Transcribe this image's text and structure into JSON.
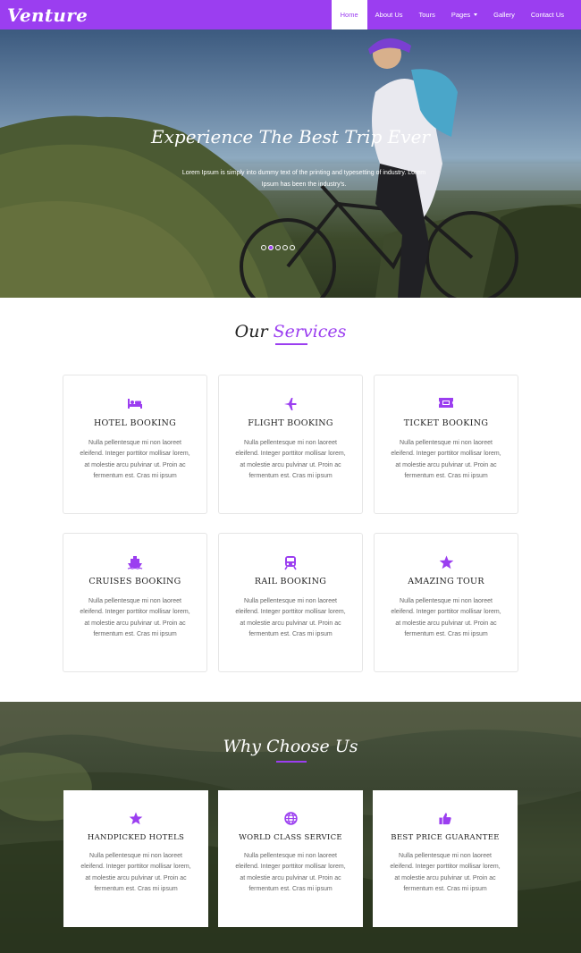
{
  "brand": "Venture",
  "nav": {
    "items": [
      {
        "label": "Home",
        "active": true
      },
      {
        "label": "About Us"
      },
      {
        "label": "Tours"
      },
      {
        "label": "Pages",
        "has_dropdown": true
      },
      {
        "label": "Gallery"
      },
      {
        "label": "Contact Us"
      }
    ]
  },
  "hero": {
    "title": "Experience The Best Trip Ever",
    "subtitle": "Lorem Ipsum is simply into dummy text of the printing and typesetting of industry. Lorem Ipsum has been the industry's.",
    "slide_count": 5,
    "active_slide": 1
  },
  "services": {
    "title_plain": "Our",
    "title_accent": "Services",
    "cards": [
      {
        "icon": "bed-icon",
        "title": "HOTEL BOOKING",
        "text": "Nulla pellentesque mi non laoreet eleifend. Integer porttitor mollisar lorem, at molestie arcu pulvinar ut. Proin ac fermentum est. Cras mi ipsum"
      },
      {
        "icon": "plane-icon",
        "title": "FLIGHT BOOKING",
        "text": "Nulla pellentesque mi non laoreet eleifend. Integer porttitor mollisar lorem, at molestie arcu pulvinar ut. Proin ac fermentum est. Cras mi ipsum"
      },
      {
        "icon": "ticket-icon",
        "title": "TICKET BOOKING",
        "text": "Nulla pellentesque mi non laoreet eleifend. Integer porttitor mollisar lorem, at molestie arcu pulvinar ut. Proin ac fermentum est. Cras mi ipsum"
      },
      {
        "icon": "ship-icon",
        "title": "CRUISES BOOKING",
        "text": "Nulla pellentesque mi non laoreet eleifend. Integer porttitor mollisar lorem, at molestie arcu pulvinar ut. Proin ac fermentum est. Cras mi ipsum"
      },
      {
        "icon": "train-icon",
        "title": "RAIL BOOKING",
        "text": "Nulla pellentesque mi non laoreet eleifend. Integer porttitor mollisar lorem, at molestie arcu pulvinar ut. Proin ac fermentum est. Cras mi ipsum"
      },
      {
        "icon": "star-icon",
        "title": "AMAZING TOUR",
        "text": "Nulla pellentesque mi non laoreet eleifend. Integer porttitor mollisar lorem, at molestie arcu pulvinar ut. Proin ac fermentum est. Cras mi ipsum"
      }
    ]
  },
  "why": {
    "title": "Why Choose Us",
    "cards": [
      {
        "icon": "star-icon",
        "title": "HANDPICKED HOTELS",
        "text": "Nulla pellentesque mi non laoreet eleifend. Integer porttitor mollisar lorem, at molestie arcu pulvinar ut. Proin ac fermentum est. Cras mi ipsum"
      },
      {
        "icon": "globe-icon",
        "title": "WORLD CLASS SERVICE",
        "text": "Nulla pellentesque mi non laoreet eleifend. Integer porttitor mollisar lorem, at molestie arcu pulvinar ut. Proin ac fermentum est. Cras mi ipsum"
      },
      {
        "icon": "thumbs-up-icon",
        "title": "BEST PRICE GUARANTEE",
        "text": "Nulla pellentesque mi non laoreet eleifend. Integer porttitor mollisar lorem, at molestie arcu pulvinar ut. Proin ac fermentum est. Cras mi ipsum"
      }
    ]
  },
  "colors": {
    "accent": "#9b3ef0",
    "text_dark": "#222222",
    "text_body": "#666666"
  }
}
